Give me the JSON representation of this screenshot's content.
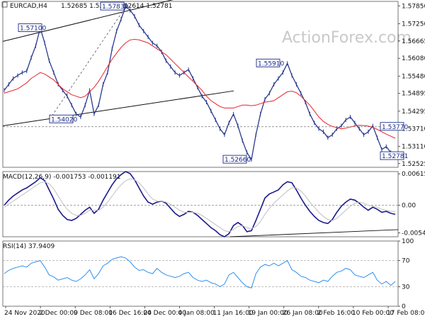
{
  "chart_data": [
    {
      "type": "line",
      "title": "EURCAD,H4",
      "ohlc_readout": "1.52685 1.52825 1.52614 1.52781",
      "watermark": "ActionForex.com",
      "ylim": [
        1.524,
        1.58
      ],
      "y_ticks": [
        "1.57850",
        "1.57250",
        "1.56665",
        "1.56080",
        "1.55480",
        "1.54895",
        "1.54295",
        "1.53710",
        "1.53110",
        "1.52525"
      ],
      "x_ticks": [
        "24 Nov 2020",
        "2 Dec 00:00",
        "9 Dec 08:00",
        "16 Dec 16:00",
        "24 Dec 00:00",
        "4 Jan 08:00",
        "11 Jan 16:00",
        "19 Jan 00:00",
        "26 Jan 08:00",
        "2 Feb 16:00",
        "10 Feb 00:00",
        "17 Feb 08:00"
      ],
      "series": [
        {
          "name": "",
          "color": "#2b3a8f",
          "values": [
            1.55,
            1.552,
            1.554,
            1.555,
            1.556,
            1.5565,
            1.561,
            1.565,
            1.571,
            1.566,
            1.56,
            1.556,
            1.552,
            1.55,
            1.548,
            1.545,
            1.542,
            1.541,
            1.545,
            1.55,
            1.542,
            1.545,
            1.552,
            1.556,
            1.564,
            1.57,
            1.574,
            1.5783,
            1.577,
            1.575,
            1.572,
            1.57,
            1.568,
            1.566,
            1.565,
            1.563,
            1.56,
            1.558,
            1.556,
            1.555,
            1.556,
            1.557,
            1.554,
            1.551,
            1.548,
            1.546,
            1.543,
            1.54,
            1.537,
            1.535,
            1.539,
            1.542,
            1.538,
            1.533,
            1.529,
            1.5266,
            1.535,
            1.542,
            1.547,
            1.549,
            1.552,
            1.554,
            1.556,
            1.5591,
            1.555,
            1.552,
            1.549,
            1.546,
            1.542,
            1.539,
            1.537,
            1.536,
            1.534,
            1.535,
            1.537,
            1.538,
            1.54,
            1.541,
            1.539,
            1.537,
            1.535,
            1.536,
            1.538,
            1.534,
            1.53,
            1.531,
            1.529,
            1.5278
          ]
        },
        {
          "name": "",
          "color": "#e8232a",
          "values": [
            1.549,
            1.5495,
            1.55,
            1.5505,
            1.5515,
            1.5525,
            1.554,
            1.555,
            1.556,
            1.5555,
            1.5545,
            1.5535,
            1.552,
            1.5505,
            1.5495,
            1.5485,
            1.548,
            1.5475,
            1.548,
            1.5495,
            1.551,
            1.553,
            1.5555,
            1.558,
            1.5605,
            1.5625,
            1.5645,
            1.566,
            1.567,
            1.5672,
            1.567,
            1.5665,
            1.566,
            1.565,
            1.564,
            1.563,
            1.562,
            1.5605,
            1.559,
            1.5575,
            1.556,
            1.5545,
            1.553,
            1.5515,
            1.55,
            1.548,
            1.5465,
            1.5455,
            1.5445,
            1.544,
            1.544,
            1.544,
            1.5445,
            1.545,
            1.545,
            1.5448,
            1.545,
            1.5455,
            1.546,
            1.5462,
            1.5465,
            1.5475,
            1.5485,
            1.5495,
            1.5497,
            1.5492,
            1.548,
            1.5465,
            1.545,
            1.543,
            1.541,
            1.5395,
            1.5385,
            1.5378,
            1.5374,
            1.537,
            1.5372,
            1.5376,
            1.538,
            1.5382,
            1.5381,
            1.5379,
            1.5375,
            1.5368,
            1.536,
            1.5352,
            1.5345,
            1.5338
          ]
        }
      ],
      "level_labels": [
        {
          "text": "1.57100",
          "value": 1.571
        },
        {
          "text": "1.57830",
          "value": 1.5783
        },
        {
          "text": "1.54020",
          "value": 1.5402
        },
        {
          "text": "1.55910",
          "value": 1.5591
        },
        {
          "text": "1.52660",
          "value": 1.5266
        },
        {
          "text": "1.53770",
          "value": 1.5377
        },
        {
          "text": "1.52781",
          "value": 1.52781
        }
      ]
    },
    {
      "type": "line",
      "title": "MACD(12,26,9) -0.001753 -0.001191",
      "ylim": [
        -0.0062,
        0.0066
      ],
      "y_ticks": [
        "0.006154",
        "0.00",
        "-0.005434"
      ],
      "series": [
        {
          "name": "",
          "color": "#1a1a8c",
          "values": [
            0.0,
            0.001,
            0.0018,
            0.0024,
            0.003,
            0.0034,
            0.004,
            0.0046,
            0.0054,
            0.0048,
            0.003,
            0.0012,
            -0.0008,
            -0.002,
            -0.0028,
            -0.003,
            -0.0026,
            -0.0018,
            -0.001,
            -0.0004,
            -0.0016,
            -0.0008,
            0.001,
            0.0025,
            0.004,
            0.0052,
            0.006,
            0.0066,
            0.0062,
            0.005,
            0.0034,
            0.0018,
            0.0006,
            0.0002,
            0.0006,
            0.0008,
            0.0004,
            -0.0006,
            -0.0016,
            -0.0022,
            -0.0018,
            -0.0012,
            -0.0014,
            -0.002,
            -0.0028,
            -0.0036,
            -0.0044,
            -0.005,
            -0.0058,
            -0.0062,
            -0.0056,
            -0.004,
            -0.0034,
            -0.004,
            -0.0052,
            -0.005,
            -0.003,
            -0.0008,
            0.0014,
            0.0022,
            0.0026,
            0.003,
            0.004,
            0.0046,
            0.0044,
            0.003,
            0.0014,
            0.0,
            -0.0012,
            -0.0022,
            -0.003,
            -0.0034,
            -0.0036,
            -0.0028,
            -0.0014,
            -0.0002,
            0.0006,
            0.0012,
            0.001,
            0.0004,
            -0.0004,
            -0.001,
            -0.0004,
            -0.0008,
            -0.0014,
            -0.0012,
            -0.0016,
            -0.0018
          ]
        },
        {
          "name": "",
          "color": "#c0c0c0",
          "values": [
            -0.0004,
            0.0002,
            0.0008,
            0.0014,
            0.002,
            0.0026,
            0.0032,
            0.0038,
            0.0044,
            0.0046,
            0.0042,
            0.0032,
            0.0018,
            0.0004,
            -0.0008,
            -0.0016,
            -0.002,
            -0.002,
            -0.0016,
            -0.001,
            -0.001,
            -0.001,
            -0.0004,
            0.0006,
            0.0018,
            0.003,
            0.004,
            0.0048,
            0.0052,
            0.005,
            0.0044,
            0.0034,
            0.0022,
            0.0012,
            0.0008,
            0.0008,
            0.0006,
            0.0002,
            -0.0004,
            -0.001,
            -0.0014,
            -0.0014,
            -0.0014,
            -0.0016,
            -0.002,
            -0.0026,
            -0.0032,
            -0.0038,
            -0.0044,
            -0.005,
            -0.0052,
            -0.0048,
            -0.0042,
            -0.004,
            -0.0044,
            -0.0046,
            -0.0042,
            -0.0032,
            -0.0018,
            -0.0006,
            0.0004,
            0.0012,
            0.002,
            0.0028,
            0.0034,
            0.0034,
            0.0028,
            0.0018,
            0.0006,
            -0.0004,
            -0.0014,
            -0.0022,
            -0.0028,
            -0.003,
            -0.0026,
            -0.0018,
            -0.001,
            -0.0002,
            0.0004,
            0.0006,
            0.0004,
            0.0,
            -0.0002,
            -0.0004,
            -0.0008,
            -0.001,
            -0.0012,
            -0.0012
          ]
        }
      ]
    },
    {
      "type": "line",
      "title": "RSI(14) 37.9409",
      "ylim": [
        0,
        100
      ],
      "y_ticks": [
        "100",
        "70",
        "30",
        "0"
      ],
      "series": [
        {
          "name": "",
          "color": "#2d8ff0",
          "values": [
            50,
            55,
            58,
            60,
            62,
            60,
            66,
            68,
            70,
            60,
            48,
            45,
            40,
            42,
            44,
            40,
            38,
            42,
            48,
            56,
            42,
            50,
            62,
            66,
            72,
            74,
            76,
            74,
            68,
            60,
            55,
            56,
            52,
            50,
            58,
            52,
            48,
            46,
            44,
            46,
            50,
            52,
            44,
            40,
            38,
            40,
            36,
            34,
            30,
            34,
            48,
            52,
            44,
            36,
            30,
            28,
            50,
            60,
            64,
            62,
            66,
            62,
            66,
            70,
            56,
            52,
            46,
            44,
            40,
            38,
            36,
            40,
            38,
            46,
            52,
            54,
            58,
            56,
            48,
            46,
            44,
            48,
            52,
            40,
            34,
            38,
            32,
            38
          ]
        }
      ]
    }
  ]
}
